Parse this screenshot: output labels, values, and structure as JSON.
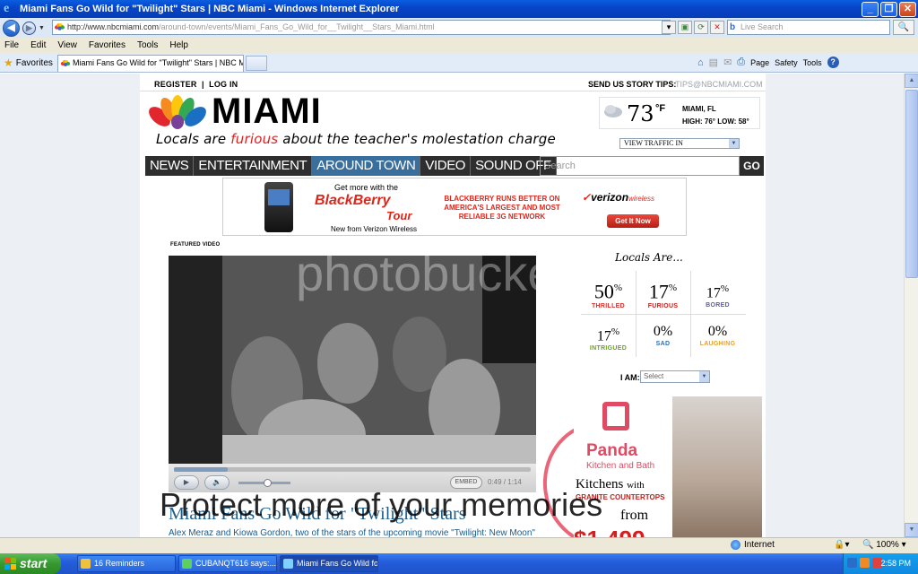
{
  "window": {
    "title": "Miami Fans Go Wild for \"Twilight\" Stars | NBC Miami - Windows Internet Explorer"
  },
  "browser": {
    "address_domain": "http://www.nbcmiami.com",
    "address_path": "/around-town/events/Miami_Fans_Go_Wild_for__Twilight__Stars_Miami.html",
    "live_search_placeholder": "Live Search",
    "menu": [
      "File",
      "Edit",
      "View",
      "Favorites",
      "Tools",
      "Help"
    ],
    "favorites_label": "Favorites",
    "tab_title": "Miami Fans Go Wild for \"Twilight\" Stars | NBC Miami",
    "commands": {
      "page": "Page",
      "safety": "Safety",
      "tools": "Tools"
    }
  },
  "site": {
    "register": "REGISTER",
    "login": "LOG IN",
    "tips_label": "SEND US STORY TIPS:",
    "tips_email": "TIPS@NBCMIAMI.COM",
    "brand": "MIAMI",
    "tagline_pre": "Locals are ",
    "tagline_hl": "furious",
    "tagline_post": " about the teacher's molestation charge",
    "weather": {
      "temp": "73",
      "unit": "°F",
      "city": "MIAMI, FL",
      "hilo": "HIGH: 76°  LOW: 58°"
    },
    "traffic": "VIEW TRAFFIC IN",
    "nav": [
      "NEWS",
      "ENTERTAINMENT",
      "AROUND TOWN",
      "VIDEO",
      "SOUND OFF"
    ],
    "search_placeholder": "Search",
    "search_go": "GO"
  },
  "ad_banner": {
    "get_more": "Get more with the",
    "blackberry": "BlackBerry",
    "tour": "Tour",
    "new_from": "New from Verizon Wireless",
    "runs_better": "BLACKBERRY RUNS BETTER ON AMERICA'S LARGEST AND MOST RELIABLE 3G NETWORK",
    "verizon": "verizon",
    "wireless": "wireless",
    "get_it_now": "Get It Now"
  },
  "featured": {
    "label": "FEATURED VIDEO",
    "embed": "EMBED",
    "time": "0:49 / 1:14",
    "progress": 0.15,
    "title": "Miami Fans Go Wild for \"Twilight\" Stars",
    "lede": "Alex Meraz and Kiowa Gordon, two of the stars of the upcoming movie \"Twilight: New Moon\""
  },
  "moods": {
    "title": "Locals Are...",
    "items": [
      {
        "pct": "50",
        "label": "THRILLED",
        "color": "#d9302b"
      },
      {
        "pct": "17",
        "label": "FURIOUS",
        "color": "#c0201a"
      },
      {
        "pct": "17",
        "label": "BORED",
        "color": "#5a5fb0"
      },
      {
        "pct": "17",
        "label": "INTRIGUED",
        "color": "#6aa12b"
      },
      {
        "pct": "0",
        "label": "SAD",
        "color": "#2c6fb5"
      },
      {
        "pct": "0",
        "label": "LAUGHING",
        "color": "#e6a12b"
      }
    ],
    "iam_label": "I AM:",
    "iam_select": "Select"
  },
  "panda_ad": {
    "panda": "Panda",
    "kb": "Kitchen and Bath",
    "kitchens": "Kitchens",
    "with": "with",
    "granite": "GRANITE COUNTERTOPS",
    "from": "from",
    "price": "$1,499"
  },
  "overlay_text": "Protect more of your memories",
  "watermark": "photobucket",
  "status": {
    "zone": "Internet",
    "zoom": "100%"
  },
  "taskbar": {
    "start": "start",
    "tasks": [
      "16 Reminders",
      "CUBANQT616 says:...",
      "Miami Fans Go Wild fo..."
    ],
    "clock": "2:58 PM"
  }
}
